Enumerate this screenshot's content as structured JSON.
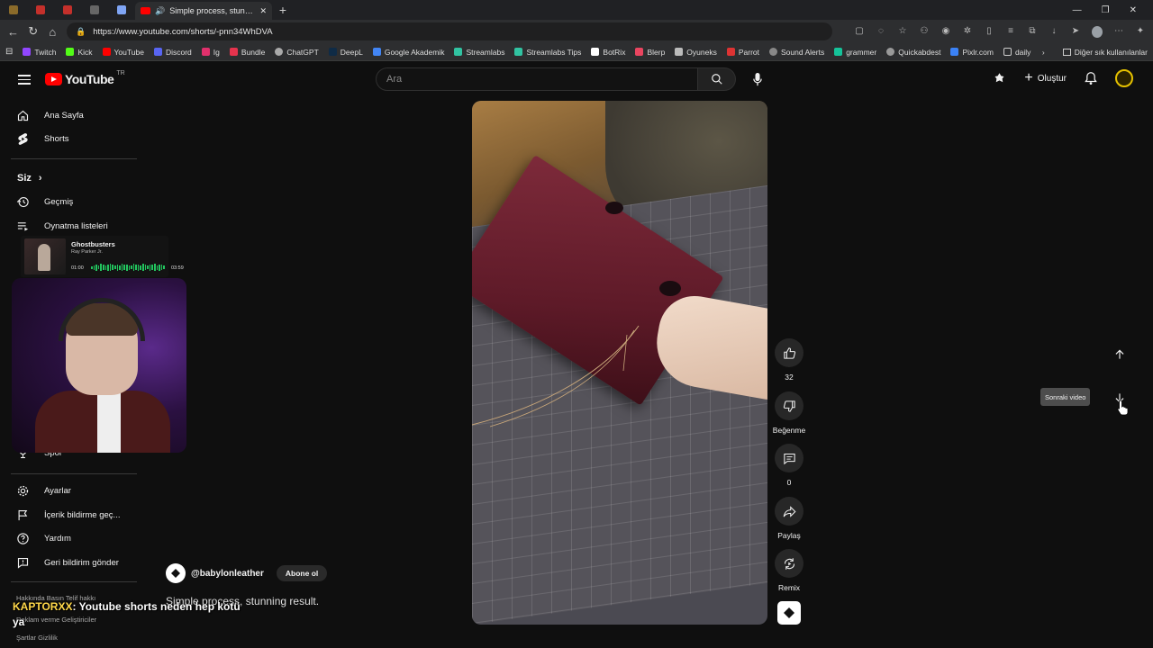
{
  "browser": {
    "tab_title": "Simple process, stunning re",
    "url": "https://www.youtube.com/shorts/-pnn34WhDVA",
    "bookmarks": [
      "Twitch",
      "Kick",
      "YouTube",
      "Discord",
      "Ig",
      "Bundle",
      "ChatGPT",
      "DeepL",
      "Google Akademik",
      "Streamlabs",
      "Streamlabs Tips",
      "BotRix",
      "Blerp",
      "Oyuneks",
      "Parrot",
      "Sound Alerts",
      "grammer",
      "Quickabdest",
      "Pixlr.com",
      "daily"
    ],
    "bookmarks_overflow": "Diğer sık kullanılanlar"
  },
  "header": {
    "logo_text": "YouTube",
    "country_code": "TR",
    "search_placeholder": "Ara",
    "create_label": "Oluştur"
  },
  "sidebar": {
    "home": "Ana Sayfa",
    "shorts": "Shorts",
    "you_section": "Siz",
    "history": "Geçmiş",
    "playlists": "Oynatma listeleri",
    "sports": "Spor",
    "settings": "Ayarlar",
    "report_history": "İçerik bildirme geç...",
    "help": "Yardım",
    "feedback": "Geri bildirim gönder",
    "footer_line1": "Hakkında  Basın  Telif hakkı",
    "footer_line2": "Reklam verme  Geliştiriciler",
    "footer_line3": "Şartlar  Gizlilik"
  },
  "music_widget": {
    "title": "Ghostbusters",
    "artist": "Ray Parker Jr.",
    "time_current": "01:00",
    "time_total": "03:59"
  },
  "actions": {
    "like_count": "32",
    "dislike_label": "Beğenme",
    "comment_count": "0",
    "share_label": "Paylaş",
    "remix_label": "Remix"
  },
  "nav": {
    "next_tooltip": "Sonraki video"
  },
  "channel": {
    "handle": "@babylonleather",
    "subscribe_label": "Abone ol",
    "video_title": "Simple process, stunning result."
  },
  "chat": {
    "user": "KAPTORXX",
    "message": ": Youtube shorts neden hep kotü",
    "message_cont": "ya"
  }
}
